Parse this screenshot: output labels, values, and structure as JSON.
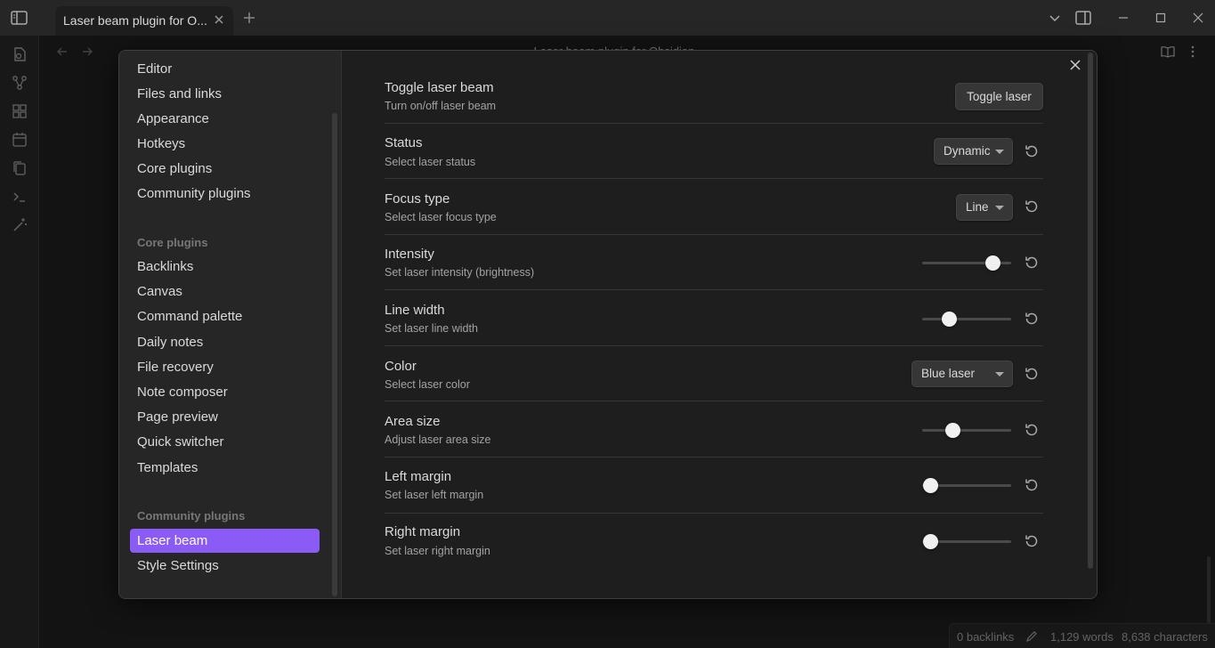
{
  "titlebar": {
    "tab_title": "Laser beam plugin for O...",
    "background_title": "Laser beam plugin for Obsidian"
  },
  "sidebar": {
    "options": [
      "Editor",
      "Files and links",
      "Appearance",
      "Hotkeys",
      "Core plugins",
      "Community plugins"
    ],
    "core_heading": "Core plugins",
    "core_items": [
      "Backlinks",
      "Canvas",
      "Command palette",
      "Daily notes",
      "File recovery",
      "Note composer",
      "Page preview",
      "Quick switcher",
      "Templates"
    ],
    "community_heading": "Community plugins",
    "community_items": [
      "Laser beam",
      "Style Settings"
    ],
    "active_item": "Laser beam"
  },
  "settings": [
    {
      "name": "Toggle laser beam",
      "desc": "Turn on/off laser beam",
      "control": "button",
      "button_label": "Toggle laser"
    },
    {
      "name": "Status",
      "desc": "Select laser status",
      "control": "dropdown",
      "value": "Dynamic"
    },
    {
      "name": "Focus type",
      "desc": "Select laser focus type",
      "control": "dropdown",
      "value": "Line"
    },
    {
      "name": "Intensity",
      "desc": "Set laser intensity (brightness)",
      "control": "slider",
      "level": 0.79
    },
    {
      "name": "Line width",
      "desc": "Set laser line width",
      "control": "slider",
      "level": 0.3
    },
    {
      "name": "Color",
      "desc": "Select laser color",
      "control": "dropdown",
      "value": "Blue laser"
    },
    {
      "name": "Area size",
      "desc": "Adjust laser area size",
      "control": "slider",
      "level": 0.34
    },
    {
      "name": "Left margin",
      "desc": "Set laser left margin",
      "control": "slider",
      "level": 0.09
    },
    {
      "name": "Right margin",
      "desc": "Set laser right margin",
      "control": "slider",
      "level": 0.09
    }
  ],
  "statusbar": {
    "backlinks": "0 backlinks",
    "words": "1,129 words",
    "characters": "8,638 characters"
  },
  "colors": {
    "accent": "#8a5cf5",
    "background": "#1e1e1e",
    "sidebar": "#262626"
  }
}
